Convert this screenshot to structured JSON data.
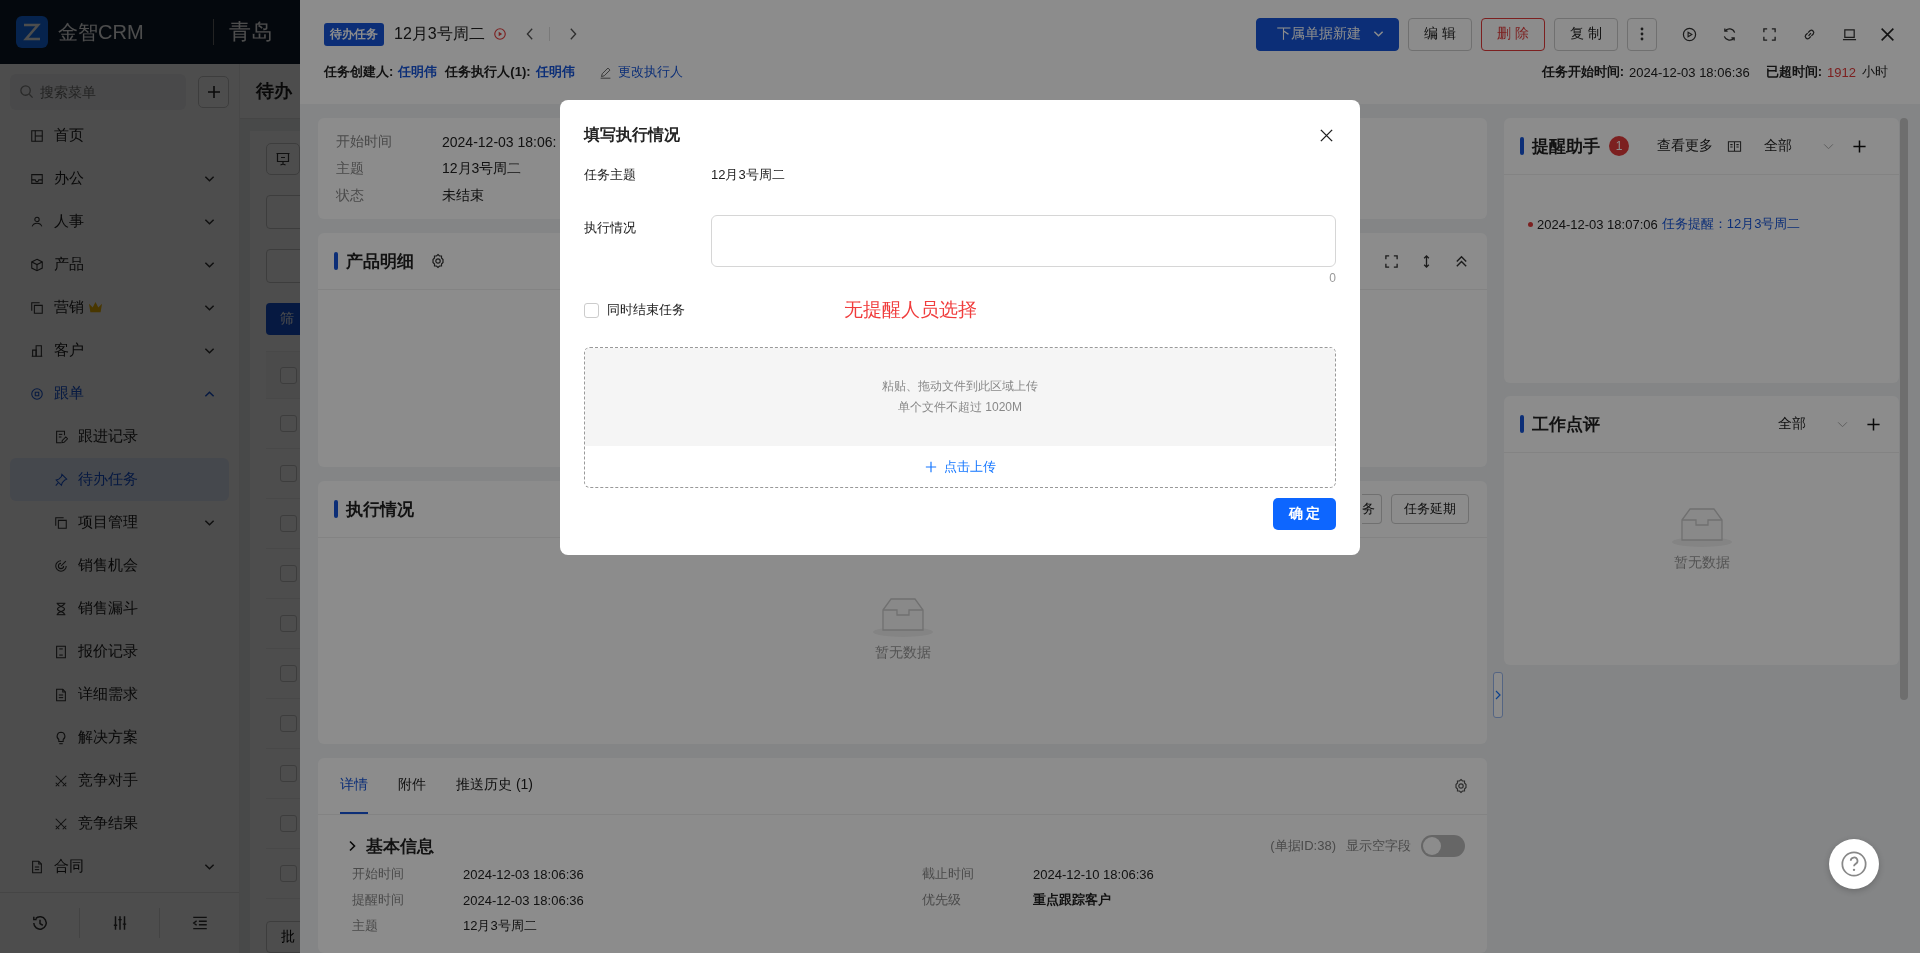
{
  "topbar": {
    "logo": "金智CRM",
    "company": "青岛"
  },
  "sidebar": {
    "search_placeholder": "搜索菜单",
    "items": [
      {
        "label": "首页",
        "kind": "link",
        "selected": false
      },
      {
        "label": "办公",
        "kind": "group",
        "expanded": false,
        "selected": false
      },
      {
        "label": "人事",
        "kind": "group",
        "expanded": false,
        "selected": false
      },
      {
        "label": "产品",
        "kind": "group",
        "expanded": false,
        "selected": false
      },
      {
        "label": "营销",
        "kind": "group",
        "expanded": false,
        "selected": false
      },
      {
        "label": "客户",
        "kind": "group",
        "expanded": false,
        "selected": false
      },
      {
        "label": "跟单",
        "kind": "group",
        "expanded": true,
        "selected": true,
        "children": [
          {
            "label": "跟进记录",
            "kind": "link",
            "selected": false
          },
          {
            "label": "待办任务",
            "kind": "link",
            "selected": true
          },
          {
            "label": "项目管理",
            "kind": "group",
            "expanded": false,
            "selected": false
          },
          {
            "label": "销售机会",
            "kind": "link",
            "selected": false
          },
          {
            "label": "销售漏斗",
            "kind": "link",
            "selected": false
          },
          {
            "label": "报价记录",
            "kind": "link",
            "selected": false
          },
          {
            "label": "详细需求",
            "kind": "link",
            "selected": false
          },
          {
            "label": "解决方案",
            "kind": "link",
            "selected": false
          },
          {
            "label": "竞争对手",
            "kind": "link",
            "selected": false
          },
          {
            "label": "竞争结果",
            "kind": "link",
            "selected": false
          }
        ]
      },
      {
        "label": "合同",
        "kind": "group",
        "expanded": false,
        "selected": false
      }
    ]
  },
  "background_page": {
    "title": "待办",
    "filter_button": "筛",
    "batch_button": "批",
    "rows": [
      {
        "checked": false
      },
      {
        "checked": false
      },
      {
        "checked": false
      },
      {
        "checked": false
      },
      {
        "checked": false
      },
      {
        "checked": false
      },
      {
        "checked": false
      },
      {
        "checked": false
      },
      {
        "checked": false
      },
      {
        "checked": false
      },
      {
        "checked": false
      }
    ]
  },
  "drawer": {
    "tag": "待办任务",
    "title": "12月3号周二",
    "actions": [
      {
        "label": "下属单据新建",
        "kind": "primary"
      },
      {
        "label": "编 辑",
        "kind": "default"
      },
      {
        "label": "删 除",
        "kind": "danger"
      },
      {
        "label": "复 制",
        "kind": "default"
      }
    ],
    "people": [
      {
        "label": "任务创建人:",
        "value": "任明伟"
      },
      {
        "label": "任务执行人(1):",
        "value": "任明伟"
      }
    ],
    "change_link": "更改执行人",
    "start_label": "任务开始时间:",
    "start_value": "2024-12-03 18:06:36",
    "overdue_label": "已超时间:",
    "overdue_value": "1912",
    "overdue_unit": "小时",
    "summary": [
      {
        "label": "开始时间",
        "value": "2024-12-03 18:06:"
      },
      {
        "label": "主题",
        "value": "12月3号周二"
      },
      {
        "label": "状态",
        "value": "未结束"
      }
    ],
    "products": {
      "title": "产品明细"
    },
    "execution": {
      "title": "执行情况",
      "buttons": [
        "务",
        "任务延期"
      ],
      "empty": "暂无数据"
    },
    "tabs": [
      {
        "label": "详情",
        "selected": true
      },
      {
        "label": "附件",
        "selected": false
      },
      {
        "label": "推送历史 (1)",
        "selected": false
      }
    ],
    "basic_info": {
      "title": "基本信息",
      "record_id": "(单据ID:38)",
      "show_empty_label": "显示空字段",
      "show_empty_on": false,
      "fields": [
        {
          "label": "开始时间",
          "value": "2024-12-03 18:06:36",
          "emphasis": false
        },
        {
          "label": "截止时间",
          "value": "2024-12-10 18:06:36",
          "emphasis": false
        },
        {
          "label": "提醒时间",
          "value": "2024-12-03 18:06:36",
          "emphasis": false
        },
        {
          "label": "优先级",
          "value": "重点跟踪客户",
          "emphasis": true
        },
        {
          "label": "主题",
          "value": "12月3号周二",
          "emphasis": false
        }
      ]
    },
    "reminders": {
      "title": "提醒助手",
      "count": "1",
      "more": "查看更多",
      "filter": "全部",
      "items": [
        {
          "time": "2024-12-03 18:07:06",
          "text": "任务提醒：12月3号周二"
        }
      ]
    },
    "reviews": {
      "title": "工作点评",
      "filter": "全部",
      "empty": "暂无数据"
    }
  },
  "modal": {
    "title": "填写执行情况",
    "subject_label": "任务主题",
    "subject_value": "12月3号周二",
    "exec_label": "执行情况",
    "counter": "0",
    "end_task_label": "同时结束任务",
    "end_task_checked": false,
    "warning": "无提醒人员选择",
    "upload_hint": "粘贴、拖动文件到此区域上传",
    "upload_limit": "单个文件不超过 1020M",
    "upload_button": "点击上传",
    "confirm": "确 定"
  }
}
